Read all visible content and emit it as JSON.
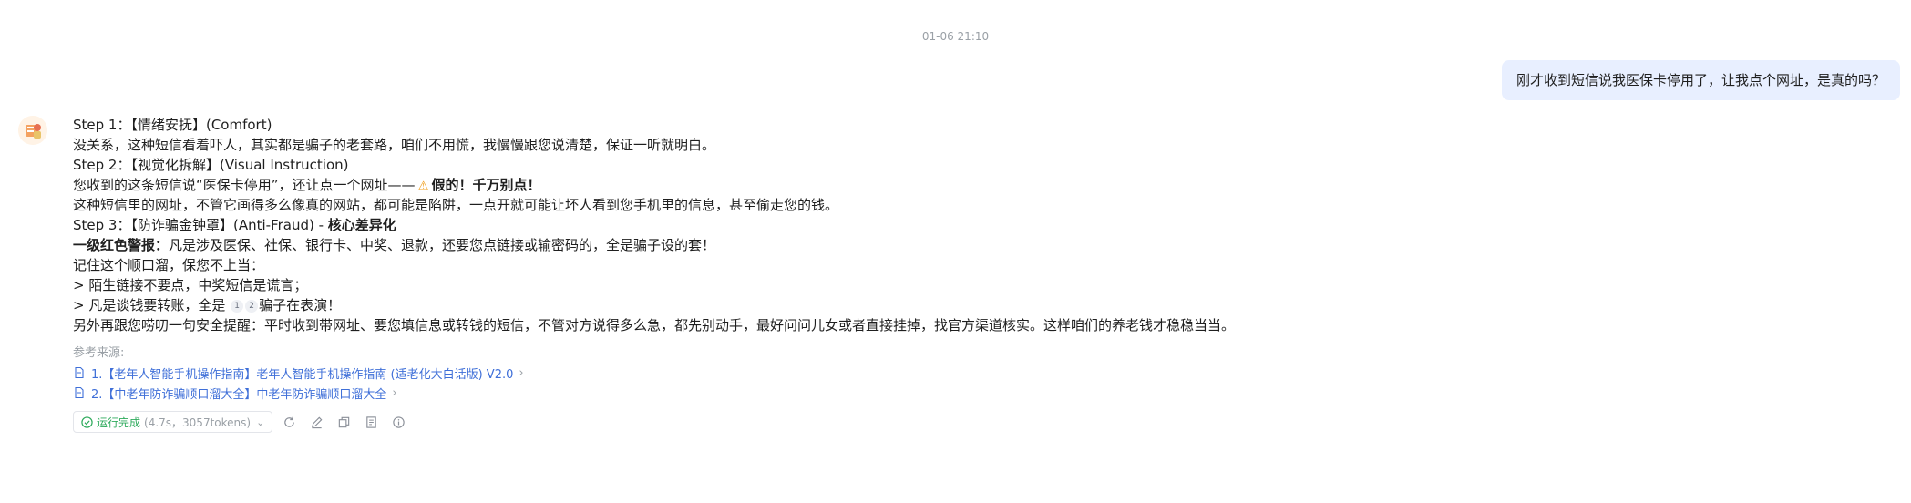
{
  "timestamp": "01-06 21:10",
  "user_message": "刚才收到短信说我医保卡停用了，让我点个网址，是真的吗？",
  "answer": {
    "step1_prefix": "Step 1：【情绪安抚】(Comfort)",
    "step1_body": "没关系，这种短信看着吓人，其实都是骗子的老套路，咱们不用慌，我慢慢跟您说清楚，保证一听就明白。",
    "step2_prefix": "Step 2：【视觉化拆解】(Visual Instruction)",
    "step2_line1_text": "您收到的这条短信说“医保卡停用”，还让点一个网址——",
    "step2_line1_bold": "假的！千万别点！",
    "step2_line2": "这种短信里的网址，不管它画得多么像真的网站，都可能是陷阱，一点开就可能让坏人看到您手机里的信息，甚至偷走您的钱。",
    "step3_prefix": "Step 3：【防诈骗金钟罩】(Anti-Fraud) - ",
    "step3_bold": "核心差异化",
    "alert_bold": "一级红色警报：",
    "alert_text": "凡是涉及医保、社保、银行卡、中奖、退款，还要您点链接或输密码的，全是骗子设的套！",
    "rhyme_intro": "记住这个顺口溜，保您不上当：",
    "rhyme1": "> 陌生链接不要点，中奖短信是谎言；",
    "rhyme2_pre": "> 凡是谈钱要转账，全是",
    "cite1": "1",
    "cite2": "2",
    "rhyme2_post": "骗子在表演！",
    "final": "另外再跟您唠叨一句安全提醒：平时收到带网址、要您填信息或转钱的短信，不管对方说得多么急，都先别动手，最好问问儿女或者直接挂掉，找官方渠道核实。这样咱们的养老钱才稳稳当当。"
  },
  "references": {
    "title": "参考来源:",
    "items": [
      {
        "label": "1.【老年人智能手机操作指南】老年人智能手机操作指南 (适老化大白话版) V2.0"
      },
      {
        "label": "2.【中老年防诈骗顺口溜大全】中老年防诈骗顺口溜大全"
      }
    ]
  },
  "toolbar": {
    "status": "运行完成",
    "meta": "(4.7s，3057tokens)"
  },
  "icons": {
    "status": "check-circle-icon",
    "regenerate": "refresh-icon",
    "edit": "pencil-icon",
    "copy": "copy-icon",
    "notes": "document-icon",
    "info": "info-icon",
    "reference": "file-icon",
    "warning": "warning-icon"
  },
  "colors": {
    "user_bubble": "#e8efff",
    "link": "#3f6fd8",
    "success": "#2eaa5c",
    "warning": "#f0a020",
    "muted": "#9aa0a6"
  }
}
